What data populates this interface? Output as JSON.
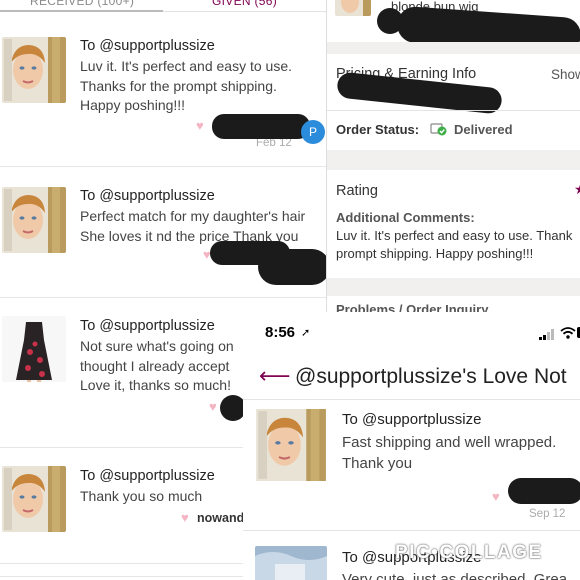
{
  "left_panel": {
    "tabs": {
      "received": "RECEIVED (100+)",
      "given": "GIVEN (56)"
    },
    "notes": [
      {
        "to": "To @supportplussize",
        "lines": [
          "Luv it. It's perfect and easy to use.",
          "Thanks for the prompt shipping.",
          "Happy poshing!!!"
        ],
        "date": "Feb 12",
        "badge": "P"
      },
      {
        "to": "To @supportplussize",
        "lines": [
          "Perfect match for my daughter's hair",
          "She loves it nd the price Thank you"
        ]
      },
      {
        "to": "To @supportplussize",
        "lines": [
          "Not sure what's going on",
          "thought I already accept",
          "Love it, thanks so much!"
        ]
      },
      {
        "to": "To @supportplussize",
        "lines": [
          "Thank you so much"
        ],
        "signer": "nowand"
      }
    ]
  },
  "order_panel": {
    "item_name": "blonde bun wig",
    "pricing_title": "Pricing & Earning Info",
    "pricing_link": "Show",
    "order_status_label": "Order Status:",
    "order_status_value": "Delivered",
    "rating_title": "Rating",
    "additional_comments_label": "Additional Comments:",
    "comment_lines": [
      "Luv it. It's perfect and easy to use. Thank",
      "prompt shipping. Happy poshing!!!"
    ],
    "problems_title": "Problems / Order Inquiry"
  },
  "phone_panel": {
    "time": "8:56",
    "nav_title": "@supportplussize's Love Not",
    "notes": [
      {
        "to": "To @supportplussize",
        "lines": [
          "Fast shipping and well wrapped.",
          "Thank you"
        ],
        "date": "Sep 12"
      },
      {
        "to": "To @supportplussize",
        "lines": [
          "Very cute, just as described. Grea"
        ]
      }
    ],
    "watermark": "PIC•COLLAGE"
  },
  "colors": {
    "brand": "#7f0353",
    "heart": "#f4b5c3",
    "delivered_green": "#3fae49",
    "badge_blue": "#2c8cdc"
  },
  "icons": [
    "heart-icon",
    "back-arrow-icon",
    "delivered-check-icon",
    "star-icon",
    "location-arrow-icon",
    "signal-icon",
    "wifi-icon",
    "battery-icon"
  ]
}
